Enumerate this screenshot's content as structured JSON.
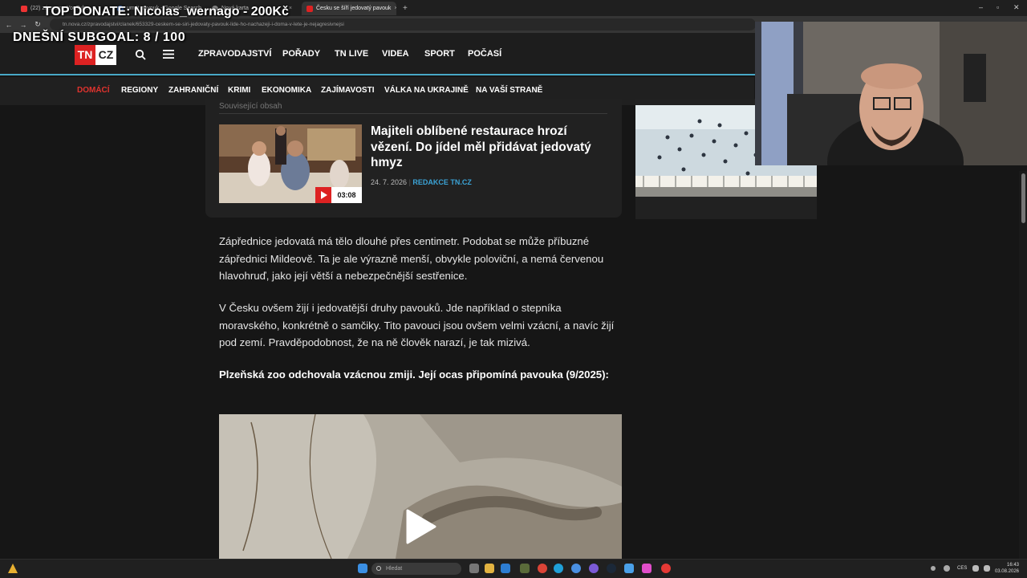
{
  "browser": {
    "tabs": [
      {
        "label": "(22) záznam - YouTube",
        "fav_color": "#e33"
      },
      {
        "label": "umrit pavouk - Google Search",
        "fav_color": "#4a8af4"
      },
      {
        "label": "Nová karta",
        "fav_color": "#888"
      },
      {
        "label": "Česku se šíří jedovatý pavouk",
        "fav_color": "#d22"
      }
    ],
    "new_tab": "+",
    "url": "tn.nova.cz/zpravodajstvi/clanek/653329-ceskem-se-siri-jedovaty-pavouk-lide-ho-nachazeji-i-doma-v-lete-je-nejagresivnejsi"
  },
  "overlay": {
    "top_donate": "TOP DONATE: Nicolas_wernago - 200Kč",
    "subgoal": "DNEŠNÍ SUBGOAL: 8 / 100"
  },
  "site": {
    "logo_tn": "TN",
    "logo_cz": "CZ",
    "main_nav": [
      "ZPRAVODAJSTVÍ",
      "POŘADY",
      "TN LIVE",
      "VIDEA",
      "SPORT",
      "POČASÍ"
    ],
    "sub_nav": [
      "DOMÁCÍ",
      "REGIONY",
      "ZAHRANIČNÍ",
      "KRIMI",
      "EKONOMIKA",
      "ZAJÍMAVOSTI",
      "VÁLKA NA UKRAJINĚ",
      "NA VAŠÍ STRANĚ"
    ],
    "sub_nav_active": "DOMÁCÍ",
    "accent_color": "#e0332e",
    "link_color": "#3ba3d6"
  },
  "related": {
    "label": "Související obsah",
    "title": "Majiteli oblíbené restaurace hrozí vězení. Do jídel měl přidávat jedovatý hmyz",
    "date": "24. 7. 2026",
    "source": "REDAKCE TN.CZ",
    "duration": "03:08"
  },
  "article": {
    "para1": "Zápřednice jedovatá má tělo dlouhé přes centimetr. Podobat se může příbuzné zápřednici Mildeově. Ta je ale výrazně menší, obvykle poloviční, a nemá červenou hlavohruď, jako její větší a nebezpečnější sestřenice.",
    "para2": "V Česku ovšem žijí i jedovatější druhy pavouků. Jde například o stepníka moravského, konkrétně o samčiky. Tito pavouci jsou ovšem velmi vzácní, a navíc žijí pod zemí. Pravděpodobnost, že na ně člověk narazí, je tak mizivá.",
    "para3": "Plzeňská zoo odchovala vzácnou zmiji. Její ocas připomíná pavouka (9/2025):"
  },
  "taskbar": {
    "search_placeholder": "Hledat",
    "lang": "CES",
    "time": "16:43",
    "date": "03.08.2026"
  }
}
